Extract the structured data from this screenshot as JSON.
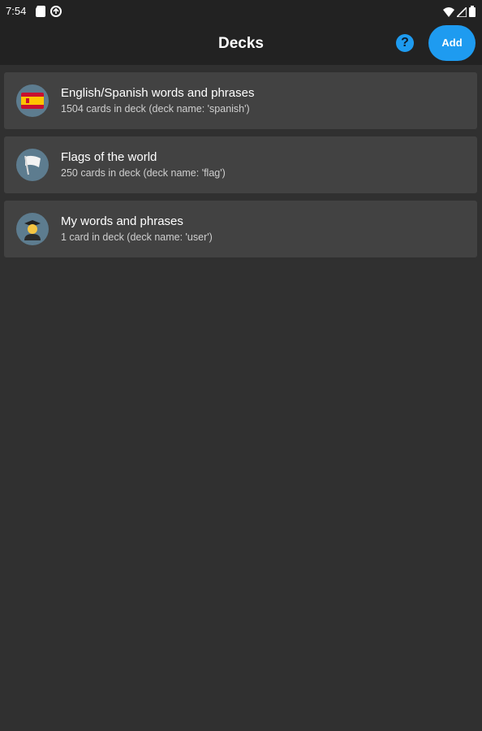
{
  "status_bar": {
    "time": "7:54",
    "icons": [
      "sd-card-icon",
      "sync-icon",
      "wifi-icon",
      "signal-icon",
      "battery-icon"
    ]
  },
  "app_bar": {
    "title": "Decks",
    "help_label": "?",
    "add_label": "Add",
    "accent_color": "#1e9bf0"
  },
  "decks": [
    {
      "icon": "spain-flag-icon",
      "title": "English/Spanish words and phrases",
      "subtitle": "1504 cards in deck (deck name: 'spanish')"
    },
    {
      "icon": "white-flag-icon",
      "title": "Flags of the world",
      "subtitle": "250 cards in deck (deck name: 'flag')"
    },
    {
      "icon": "student-icon",
      "title": "My words and phrases",
      "subtitle": "1 card in deck (deck name: 'user')"
    }
  ]
}
